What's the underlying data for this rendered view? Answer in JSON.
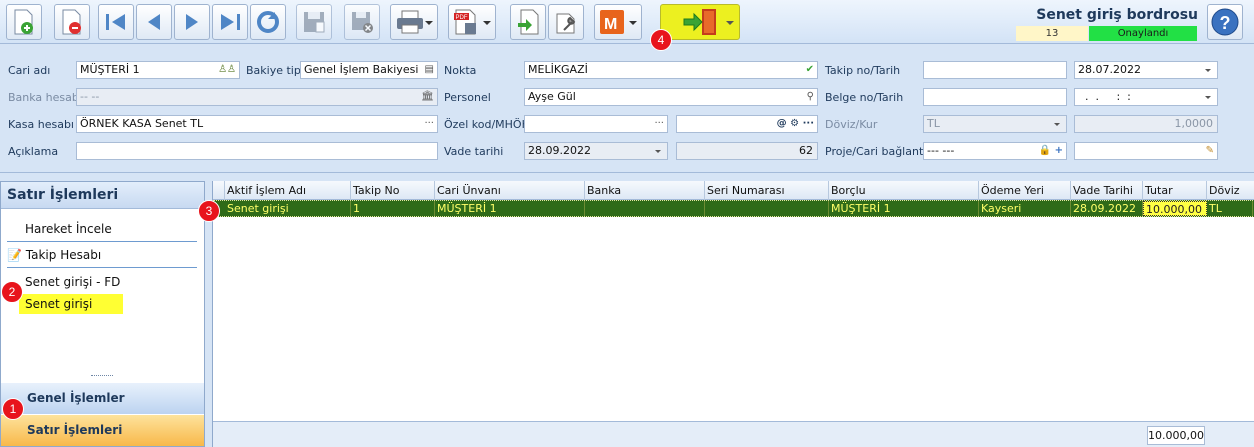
{
  "header": {
    "title": "Senet giriş bordrosu",
    "doc_number": "13",
    "status": "Onaylandı",
    "status_color": "#22e045"
  },
  "toolbar": {
    "buttons": [
      "new-document-icon",
      "delete-document-icon",
      "first-record-icon",
      "previous-record-icon",
      "next-record-icon",
      "last-record-icon",
      "refresh-icon",
      "save-icon",
      "cancel-save-icon",
      "print-icon",
      "pdf-export-icon",
      "import-icon",
      "tools-icon",
      "m-app-icon",
      "exit-door-icon",
      "help-icon"
    ]
  },
  "form": {
    "cari_adi": {
      "label": "Cari adı",
      "value": "MÜŞTERİ 1"
    },
    "bakiye_tipi": {
      "label": "Bakiye tipi",
      "value": "Genel İşlem Bakiyesi"
    },
    "banka_hesabi": {
      "label": "Banka hesabı",
      "value": "-- --"
    },
    "kasa_hesabi": {
      "label": "Kasa hesabı",
      "value": "ÖRNEK KASA Senet TL"
    },
    "aciklama": {
      "label": "Açıklama",
      "value": ""
    },
    "nokta": {
      "label": "Nokta",
      "value": "MELİKGAZİ"
    },
    "personel": {
      "label": "Personel",
      "value": "Ayşe Gül"
    },
    "ozel_kod": {
      "label": "Özel kod/MHÖK",
      "value": ""
    },
    "vade_tarihi": {
      "label": "Vade tarihi",
      "value": "28.09.2022",
      "days": "62"
    },
    "takip_no": {
      "label": "Takip no/Tarih",
      "value": "",
      "date": "28.07.2022"
    },
    "belge_no": {
      "label": "Belge no/Tarih",
      "value": "",
      "date": "  .  .     :  :"
    },
    "doviz_kur": {
      "label": "Döviz/Kur",
      "currency": "TL",
      "rate": "1,0000"
    },
    "proje": {
      "label": "Proje/Cari bağlantı",
      "value": "--- ---"
    }
  },
  "left_panel": {
    "title": "Satır İşlemleri",
    "items": [
      "Hareket İncele",
      "Takip Hesabı",
      "Senet girişi - FD",
      "Senet girişi"
    ],
    "nav_general": "Genel İşlemler",
    "nav_row": "Satır İşlemleri"
  },
  "grid": {
    "columns": [
      "Aktif İşlem Adı",
      "Takip No",
      "Cari Ünvanı",
      "Banka",
      "Seri Numarası",
      "Borçlu",
      "Ödeme Yeri",
      "Vade Tarihi",
      "Tutar",
      "Döviz"
    ],
    "rows": [
      [
        "Senet girişi",
        "1",
        "MÜŞTERİ 1",
        "",
        "",
        "MÜŞTERİ 1",
        "Kayseri",
        "28.09.2022",
        "10.000,00",
        "TL"
      ]
    ],
    "total": "10.000,00"
  },
  "badges": [
    "1",
    "2",
    "3",
    "4"
  ]
}
